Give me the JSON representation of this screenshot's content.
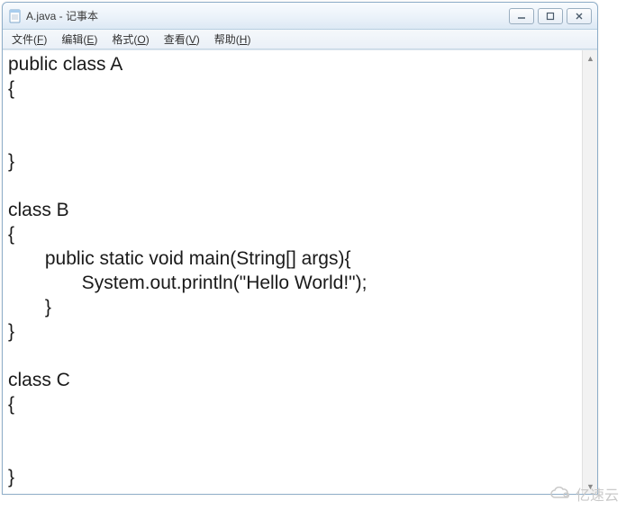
{
  "window": {
    "title": "A.java - 记事本"
  },
  "menu": {
    "file": {
      "label": "文件",
      "accel": "F"
    },
    "edit": {
      "label": "编辑",
      "accel": "E"
    },
    "format": {
      "label": "格式",
      "accel": "O"
    },
    "view": {
      "label": "查看",
      "accel": "V"
    },
    "help": {
      "label": "帮助",
      "accel": "H"
    }
  },
  "editor": {
    "content": "public class A\n{\n\n\n}\n\nclass B\n{\n       public static void main(String[] args){\n              System.out.println(\"Hello World!\");\n       }\n}\n\nclass C\n{\n\n\n}"
  },
  "watermark": {
    "text": "亿速云"
  }
}
